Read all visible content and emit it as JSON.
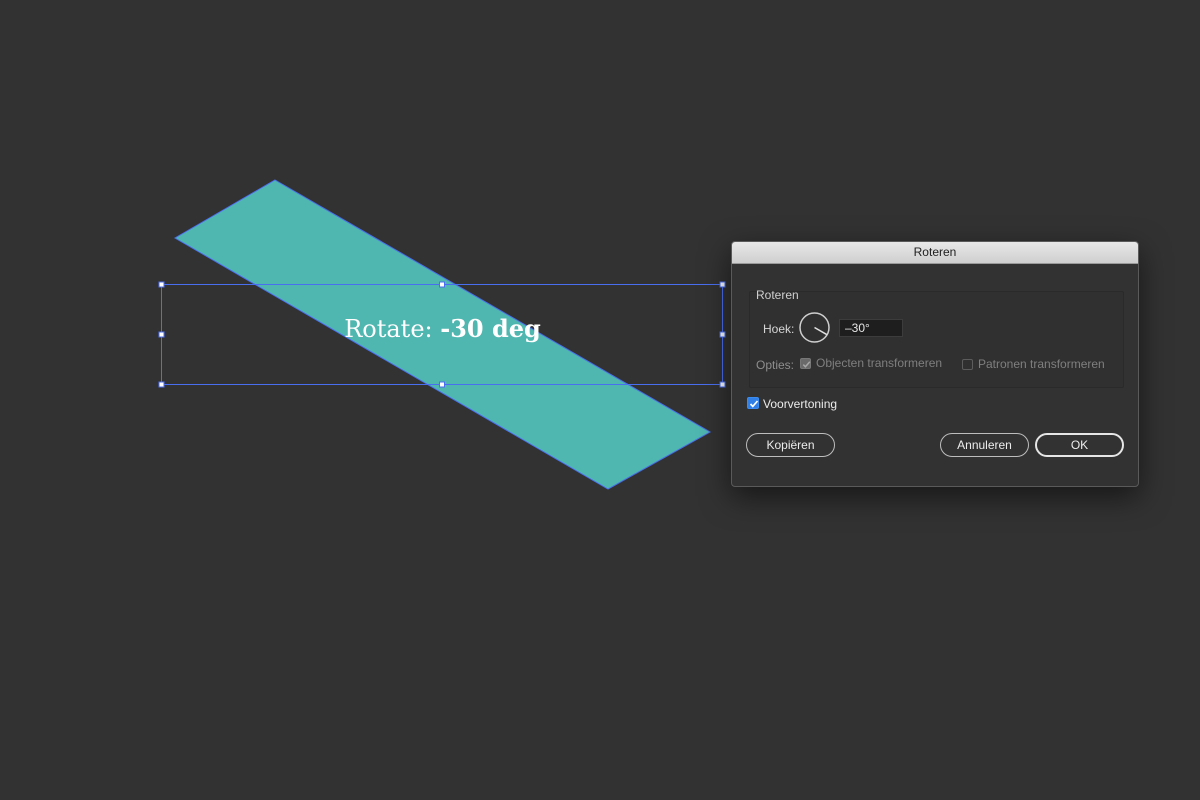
{
  "canvas": {
    "background": "#323232",
    "shape_color": "#4fb6b0",
    "selection_color": "#4a6ef0",
    "label_prefix": "Rotate:",
    "label_value": "-30 deg"
  },
  "dialog": {
    "title": "Roteren",
    "group_title": "Roteren",
    "angle_label": "Hoek:",
    "angle_value": "–30°",
    "options_label": "Opties:",
    "transform_objects_label": "Objecten transformeren",
    "transform_objects_checked": true,
    "transform_patterns_label": "Patronen transformeren",
    "transform_patterns_checked": false,
    "preview_label": "Voorvertoning",
    "preview_checked": true,
    "copy_button": "Kopiëren",
    "cancel_button": "Annuleren",
    "ok_button": "OK",
    "accent_color": "#2f7fe6"
  }
}
